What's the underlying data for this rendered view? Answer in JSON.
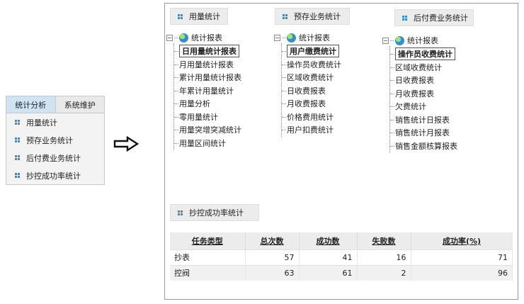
{
  "nav": {
    "tabs": [
      "统计分析",
      "系统维护"
    ],
    "items": [
      "用量统计",
      "预存业务统计",
      "后付费业务统计",
      "抄控成功率统计"
    ]
  },
  "sections": {
    "usage": {
      "title": "用量统计",
      "root": "统计报表",
      "items": [
        "日用量统计报表",
        "月用量统计报表",
        "累计用量统计报表",
        "年累计用量统计",
        "用量分析",
        "零用量统计",
        "用量突增突减统计",
        "用量区间统计"
      ],
      "selected": 0
    },
    "prepaid": {
      "title": "预存业务统计",
      "root": "统计报表",
      "items": [
        "用户缴费统计",
        "操作员收费统计",
        "区域收费统计",
        "日收费报表",
        "月收费报表",
        "价格费用统计",
        "用户扣费统计"
      ],
      "selected": 0
    },
    "postpaid": {
      "title": "后付费业务统计",
      "root": "统计报表",
      "items": [
        "操作员收费统计",
        "区域收费统计",
        "日收费报表",
        "月收费报表",
        "欠费统计",
        "销售统计日报表",
        "销售统计月报表",
        "销售金额核算报表"
      ],
      "selected": 0
    },
    "success": {
      "title": "抄控成功率统计"
    }
  },
  "table": {
    "headers": [
      "任务类型",
      "总次数",
      "成功数",
      "失败数",
      "成功率(%)"
    ],
    "rows": [
      [
        "抄表",
        "57",
        "41",
        "16",
        "71"
      ],
      [
        "控阀",
        "63",
        "61",
        "2",
        "96"
      ]
    ]
  },
  "colors": {
    "accent": "#3b8bd1",
    "active_tab": "#cfe3f2"
  }
}
